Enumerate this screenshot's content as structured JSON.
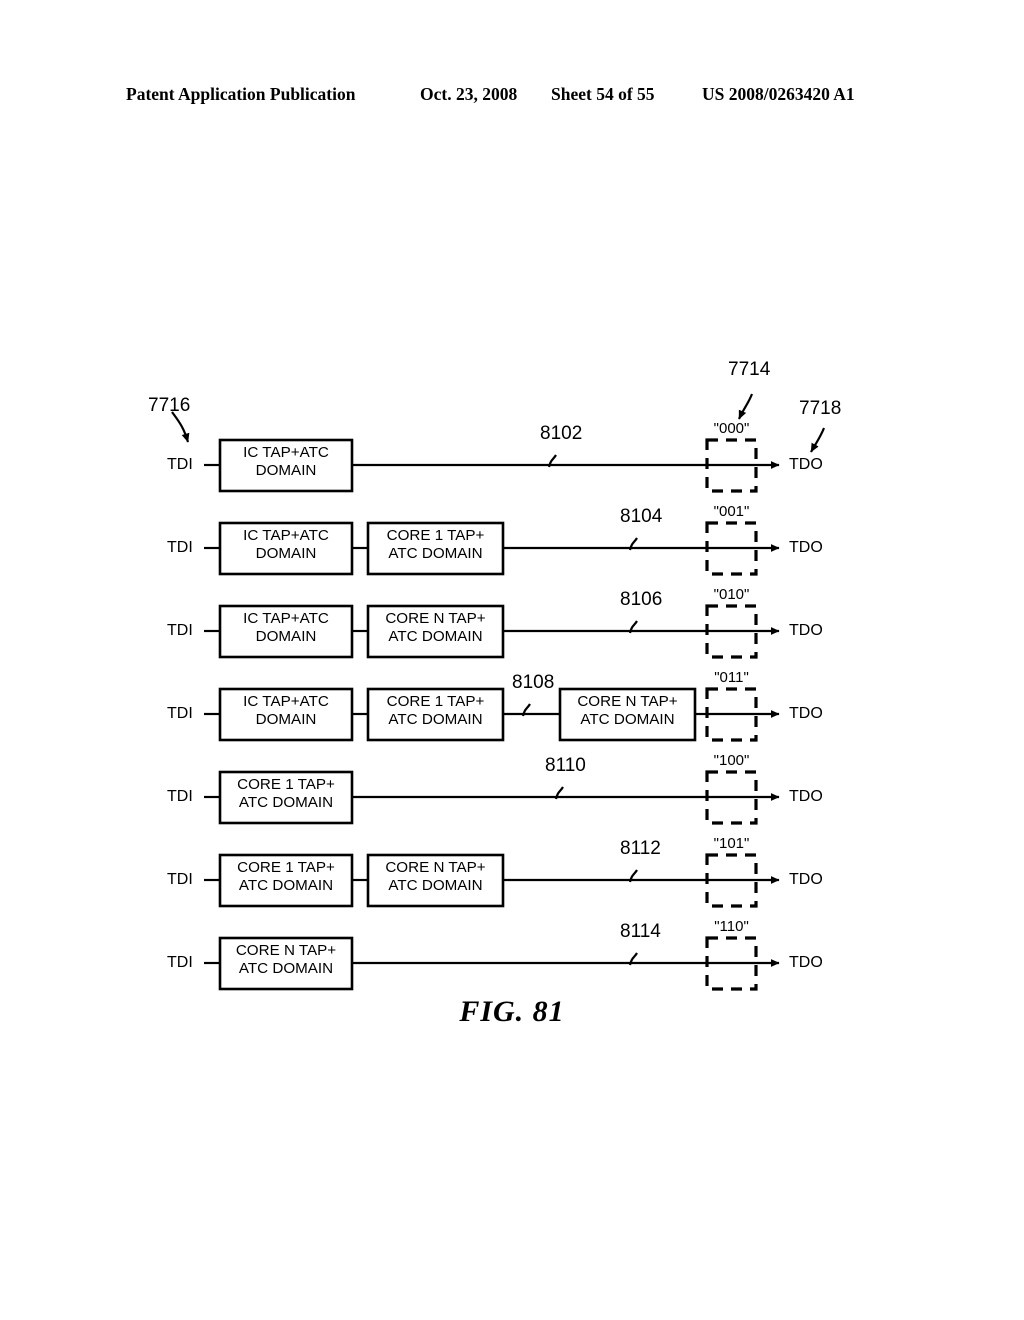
{
  "header": {
    "publication": "Patent Application Publication",
    "date": "Oct. 23, 2008",
    "sheet": "Sheet 54 of 55",
    "patent_number": "US 2008/0263420 A1"
  },
  "figure": {
    "caption": "FIG. 81"
  },
  "labels": {
    "tdi": "TDI",
    "tdo": "TDO",
    "ref_tdi": "7716",
    "ref_tdo": "7718",
    "ref_code_box": "7714"
  },
  "chains": [
    {
      "ref": "8102",
      "code": "\"000\"",
      "input": "TDI",
      "output": "TDO",
      "blocks": [
        {
          "line1": "IC TAP+ATC",
          "line2": "DOMAIN"
        }
      ]
    },
    {
      "ref": "8104",
      "code": "\"001\"",
      "input": "TDI",
      "output": "TDO",
      "blocks": [
        {
          "line1": "IC TAP+ATC",
          "line2": "DOMAIN"
        },
        {
          "line1": "CORE 1 TAP+",
          "line2": "ATC DOMAIN"
        }
      ]
    },
    {
      "ref": "8106",
      "code": "\"010\"",
      "input": "TDI",
      "output": "TDO",
      "blocks": [
        {
          "line1": "IC TAP+ATC",
          "line2": "DOMAIN"
        },
        {
          "line1": "CORE N TAP+",
          "line2": "ATC DOMAIN"
        }
      ]
    },
    {
      "ref": "8108",
      "code": "\"011\"",
      "input": "TDI",
      "output": "TDO",
      "blocks": [
        {
          "line1": "IC TAP+ATC",
          "line2": "DOMAIN"
        },
        {
          "line1": "CORE 1 TAP+",
          "line2": "ATC DOMAIN"
        },
        {
          "line1": "CORE N TAP+",
          "line2": "ATC DOMAIN"
        }
      ]
    },
    {
      "ref": "8110",
      "code": "\"100\"",
      "input": "TDI",
      "output": "TDO",
      "blocks": [
        {
          "line1": "CORE 1 TAP+",
          "line2": "ATC DOMAIN"
        }
      ]
    },
    {
      "ref": "8112",
      "code": "\"101\"",
      "input": "TDI",
      "output": "TDO",
      "blocks": [
        {
          "line1": "CORE 1 TAP+",
          "line2": "ATC DOMAIN"
        },
        {
          "line1": "CORE N TAP+",
          "line2": "ATC DOMAIN"
        }
      ]
    },
    {
      "ref": "8114",
      "code": "\"110\"",
      "input": "TDI",
      "output": "TDO",
      "blocks": [
        {
          "line1": "CORE N TAP+",
          "line2": "ATC DOMAIN"
        }
      ]
    }
  ]
}
